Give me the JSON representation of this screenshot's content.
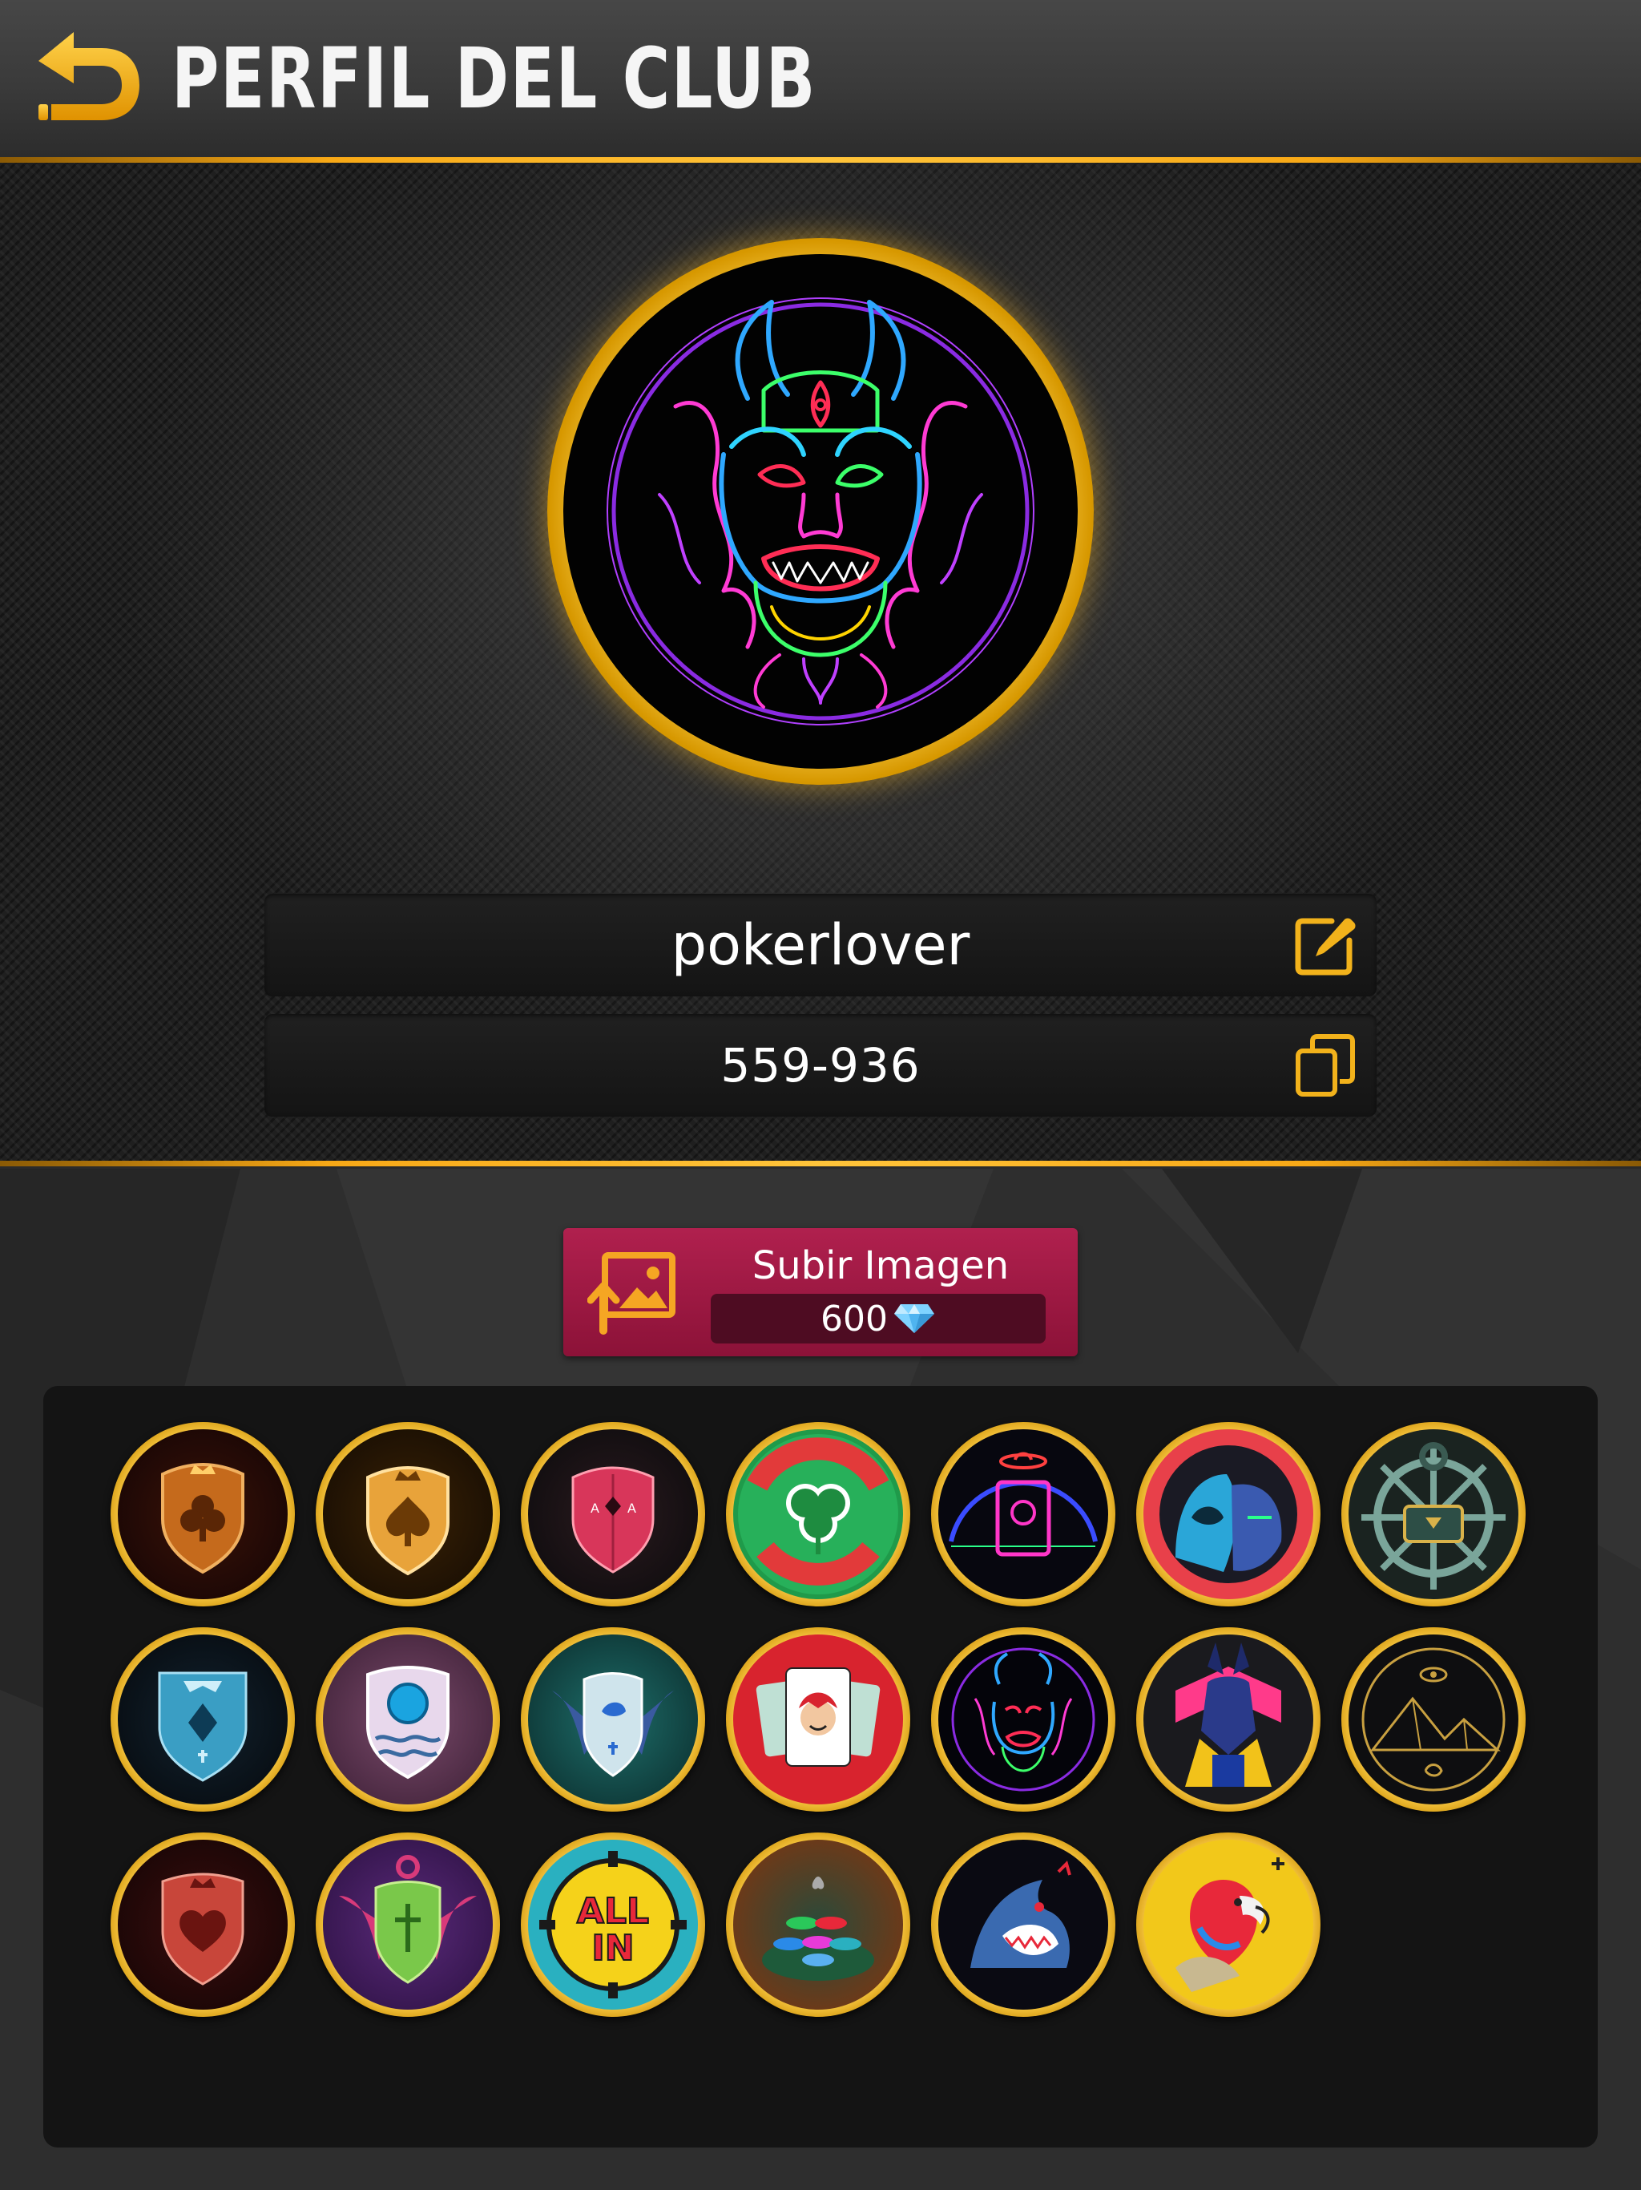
{
  "header": {
    "title": "PERFIL DEL CLUB",
    "back_icon": "back-arrow-icon"
  },
  "club": {
    "name": "pokerlover",
    "id": "559-936",
    "edit_icon": "edit-icon",
    "copy_icon": "copy-icon"
  },
  "upload": {
    "label": "Subir Imagen",
    "price": "600",
    "currency_icon": "diamond-icon"
  },
  "colors": {
    "accent_gold": "#f7a816",
    "upload_button": "#a31845",
    "panel": "#141414"
  },
  "gallery": {
    "badges": [
      {
        "name": "bronze-club-shield"
      },
      {
        "name": "gold-spade-shield"
      },
      {
        "name": "red-ace-shield"
      },
      {
        "name": "lucky-team-clover"
      },
      {
        "name": "neon-skull-card"
      },
      {
        "name": "knights-duo"
      },
      {
        "name": "anchor-treasure"
      },
      {
        "name": "blue-diamond-shield"
      },
      {
        "name": "purple-chip-shield"
      },
      {
        "name": "dragon-shield"
      },
      {
        "name": "joker-card"
      },
      {
        "name": "neon-oni-mask"
      },
      {
        "name": "anubis"
      },
      {
        "name": "eye-pyramid"
      },
      {
        "name": "red-heart-shield"
      },
      {
        "name": "green-winged-shield"
      },
      {
        "name": "all-in-chip"
      },
      {
        "name": "poker-chip-stack"
      },
      {
        "name": "shark"
      },
      {
        "name": "pirate-parrot"
      }
    ]
  }
}
